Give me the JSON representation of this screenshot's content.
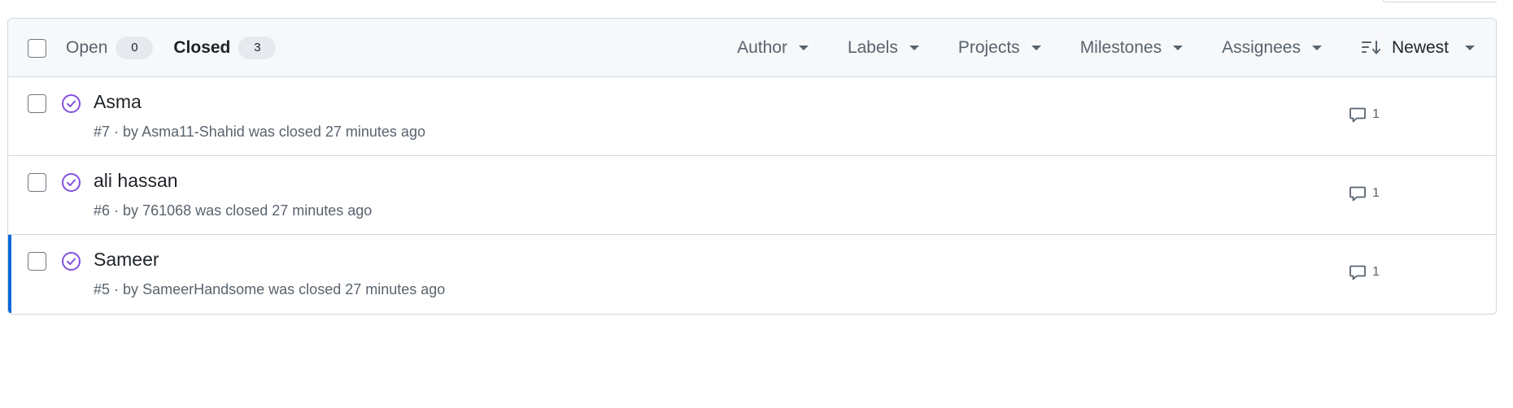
{
  "header": {
    "open": {
      "label": "Open",
      "count": "0"
    },
    "closed": {
      "label": "Closed",
      "count": "3"
    },
    "filters": {
      "author": "Author",
      "labels": "Labels",
      "projects": "Projects",
      "milestones": "Milestones",
      "assignees": "Assignees",
      "sort": "Newest"
    }
  },
  "issues": [
    {
      "title": "Asma",
      "number": "#7",
      "by": "· by",
      "author": "Asma11-Shahid",
      "status": "was closed 27 minutes ago",
      "comments": "1"
    },
    {
      "title": "ali hassan",
      "number": "#6",
      "by": "· by",
      "author": "761068",
      "status": "was closed 27 minutes ago",
      "comments": "1"
    },
    {
      "title": "Sameer",
      "number": "#5",
      "by": "· by",
      "author": "SameerHandsome",
      "status": "was closed 27 minutes ago",
      "comments": "1"
    }
  ],
  "colors": {
    "closed_icon": "#8250df",
    "focus_bar": "#0969da",
    "border": "#d0d7de",
    "header_bg": "#f6f8fa"
  },
  "icons": {
    "closed_state": "check-circle-icon",
    "comment": "comment-icon",
    "sort": "sort-desc-icon",
    "dropdown": "triangle-down-icon"
  }
}
